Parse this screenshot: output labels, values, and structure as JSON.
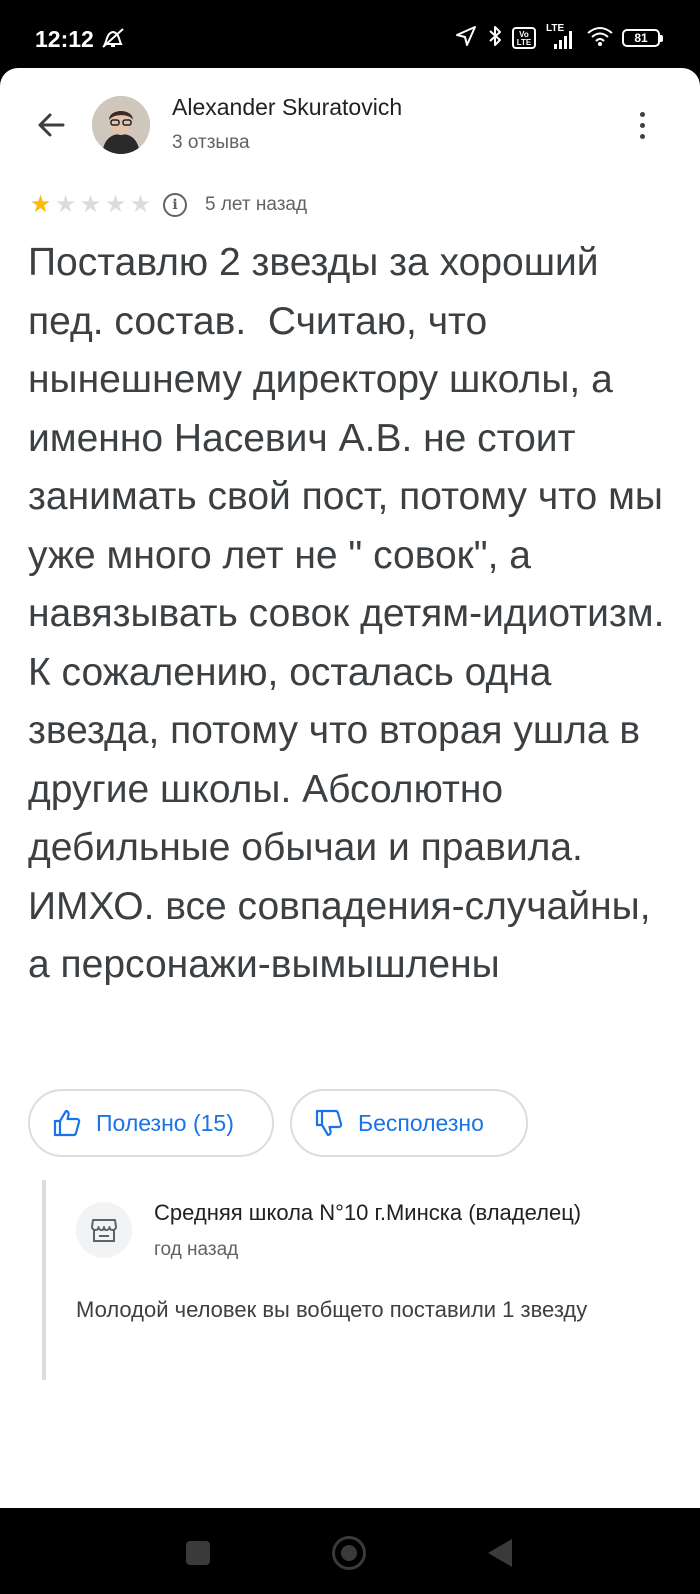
{
  "status_bar": {
    "time": "12:12",
    "signal_label": "LTE",
    "volte_label": "Vo LTE",
    "battery": "81"
  },
  "review": {
    "author": "Alexander Skuratovich",
    "author_meta": "3 отзыва",
    "rating": 1,
    "rating_max": 5,
    "date": "5 лет назад",
    "text": "Поставлю 2 звезды за хороший пед. состав.  Считаю, что нынешнему директору школы, а именно Насевич А.В. не стоит занимать свой пост, потому что мы уже много лет не \" совок\", а навязывать совок детям-идиотизм. К сожалению, осталась одна звезда, потому что вторая ушла в другие школы. Абсолютно дебильные обычаи и правила. ИМХО. все совпадения-случайны, а персонажи-вымышлены"
  },
  "feedback": {
    "helpful_label": "Полезно (15)",
    "unhelpful_label": "Бесполезно"
  },
  "owner_reply": {
    "name": "Средняя школа N°10 г.Минска (владелец)",
    "date": "год назад",
    "text": "Молодой человек вы вобщето поставили 1 звезду"
  },
  "icons": {
    "back": "arrow-left-icon",
    "more": "more-vert-icon",
    "info": "info-icon",
    "helpful": "thumb-up-icon",
    "unhelpful": "thumb-down-icon",
    "owner": "store-icon"
  },
  "colors": {
    "accent": "#1a73e8",
    "star_on": "#fbbc04",
    "star_off": "#dadce0",
    "text_primary": "#202124",
    "text_secondary": "#5f6368"
  }
}
